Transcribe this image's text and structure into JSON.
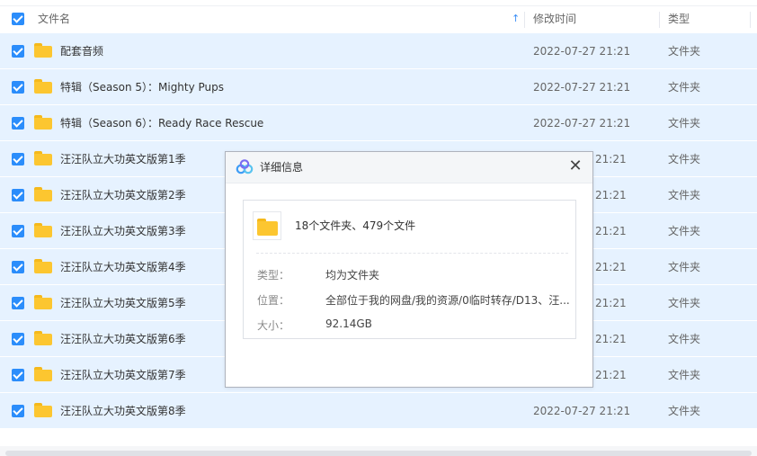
{
  "header": {
    "col_name": "文件名",
    "col_time": "修改时间",
    "col_type": "类型",
    "sort_icon": "↑"
  },
  "rows": [
    {
      "name": "配套音频",
      "time": "2022-07-27 21:21",
      "type": "文件夹"
    },
    {
      "name": "特辑（Season 5）：Mighty Pups",
      "time": "2022-07-27 21:21",
      "type": "文件夹"
    },
    {
      "name": "特辑（Season 6）：Ready Race Rescue",
      "time": "2022-07-27 21:21",
      "type": "文件夹"
    },
    {
      "name": "汪汪队立大功英文版第1季",
      "time": "21:21",
      "type": "文件夹"
    },
    {
      "name": "汪汪队立大功英文版第2季",
      "time": "21:21",
      "type": "文件夹"
    },
    {
      "name": "汪汪队立大功英文版第3季",
      "time": "21:21",
      "type": "文件夹"
    },
    {
      "name": "汪汪队立大功英文版第4季",
      "time": "21:21",
      "type": "文件夹"
    },
    {
      "name": "汪汪队立大功英文版第5季",
      "time": "21:21",
      "type": "文件夹"
    },
    {
      "name": "汪汪队立大功英文版第6季",
      "time": "21:21",
      "type": "文件夹"
    },
    {
      "name": "汪汪队立大功英文版第7季",
      "time": "21:21",
      "type": "文件夹"
    },
    {
      "name": "汪汪队立大功英文版第8季",
      "time": "2022-07-27 21:21",
      "type": "文件夹"
    }
  ],
  "dialog": {
    "title": "详细信息",
    "close": "✕",
    "summary": "18个文件夹、479个文件",
    "type_label": "类型：",
    "type_value": "均为文件夹",
    "location_label": "位置：",
    "location_value": "全部位于我的网盘/我的资源/0临时转存/D13、汪...",
    "size_label": "大小：",
    "size_value": "92.14GB"
  },
  "colors": {
    "accent": "#2b8dfb",
    "row_selected": "#e6f2ff",
    "folder": "#fcc630"
  },
  "icons": {
    "checkbox": "checkbox-checked-icon",
    "folder": "folder-icon",
    "logo": "baidu-netdisk-logo-icon",
    "close": "close-icon",
    "sort": "sort-ascending-icon"
  }
}
